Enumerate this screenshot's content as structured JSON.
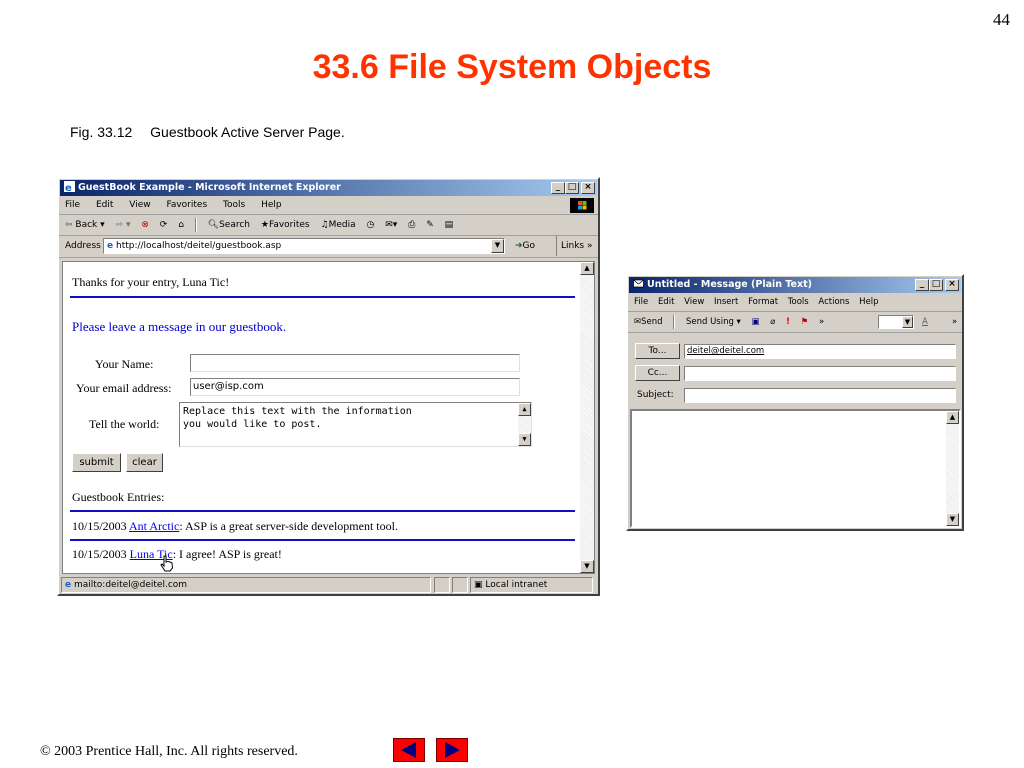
{
  "slide": {
    "page_number": "44",
    "title": "33.6 File System Objects",
    "fig_number": "Fig. 33.12",
    "fig_caption": "Guestbook Active Server Page.",
    "copyright": "© 2003 Prentice Hall, Inc.  All rights reserved."
  },
  "browser": {
    "title": "GuestBook Example - Microsoft Internet Explorer",
    "menu": [
      "File",
      "Edit",
      "View",
      "Favorites",
      "Tools",
      "Help"
    ],
    "toolbar": {
      "back": "Back",
      "search": "Search",
      "favorites": "Favorites",
      "media": "Media"
    },
    "address_label": "Address",
    "address_url": "http://localhost/deitel/guestbook.asp",
    "go_label": "Go",
    "links_label": "Links",
    "page": {
      "thanks": "Thanks for your entry, Luna Tic!",
      "heading": "Please leave a message in our guestbook.",
      "name_label": "Your Name:",
      "name_value": "",
      "email_label": "Your email address:",
      "email_value": "user@isp.com",
      "world_label": "Tell the world:",
      "textarea_lines": [
        "Replace this text with the information",
        "you would like to post."
      ],
      "submit_label": "submit",
      "clear_label": "clear",
      "entries_heading": "Guestbook Entries:",
      "entries": [
        {
          "date": "10/15/2003",
          "name": "Ant Arctic",
          "message": ": ASP is a great server-side development tool."
        },
        {
          "date": "10/15/2003",
          "name": "Luna Tic",
          "message": ": I agree! ASP is great!"
        }
      ]
    },
    "status_text": "mailto:deitel@deitel.com",
    "status_zone": "Local intranet"
  },
  "mail": {
    "title": "Untitled - Message (Plain Text)",
    "menu": [
      "File",
      "Edit",
      "View",
      "Insert",
      "Format",
      "Tools",
      "Actions",
      "Help"
    ],
    "send_label": "Send",
    "send_using_label": "Send Using",
    "to_button": "To...",
    "to_value": "deitel@deitel.com",
    "cc_button": "Cc...",
    "cc_value": "",
    "subject_label": "Subject:",
    "subject_value": ""
  }
}
